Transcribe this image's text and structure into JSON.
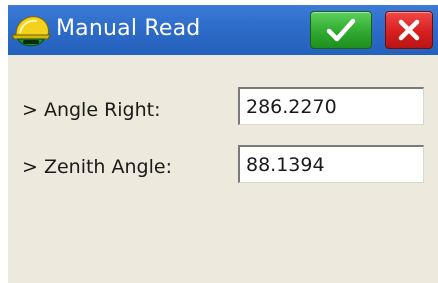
{
  "window": {
    "title": "Manual Read",
    "app_icon": "surveyor-helmet-icon"
  },
  "titlebar": {
    "ok_icon": "checkmark-icon",
    "cancel_icon": "close-icon",
    "background_color": "#2e6cc9",
    "ok_color": "#2faa2f",
    "cancel_color": "#d81f1f"
  },
  "fields": [
    {
      "label": "> Angle Right:",
      "value": "286.2270"
    },
    {
      "label": "> Zenith Angle:",
      "value": "88.1394"
    }
  ]
}
